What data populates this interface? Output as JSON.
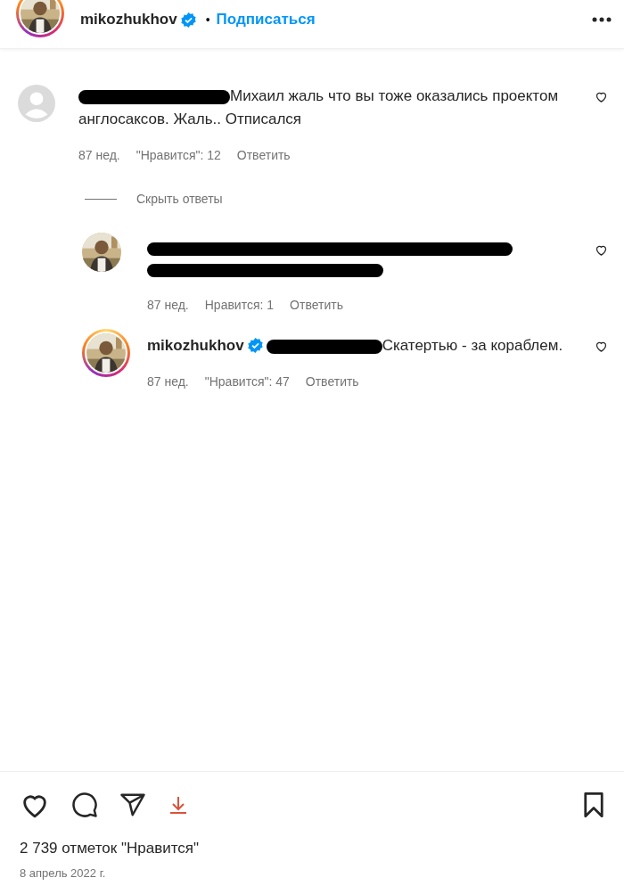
{
  "header": {
    "username": "mikozhukhov",
    "verified": true,
    "separator": "•",
    "follow": "Подписаться",
    "story_ring": true
  },
  "comments": [
    {
      "kind": "text",
      "author_redacted": true,
      "avatar": {
        "kind": "default"
      },
      "story_ring": false,
      "text": "Михаил жаль что вы тоже оказались проектом англосаксов. Жаль.. Отписался",
      "time": "87 нед.",
      "likes": "\"Нравится\": 12",
      "reply": "Ответить",
      "liked": false,
      "hide_replies": "Скрыть ответы",
      "children": [
        {
          "kind": "redacted",
          "story_ring": false,
          "time": "87 нед.",
          "likes": "Нравится: 1",
          "reply": "Ответить",
          "liked": false
        },
        {
          "kind": "text",
          "author": "mikozhukhov",
          "verified": true,
          "mention_redacted": true,
          "story_ring": true,
          "text": "Скатертью - за кораблем.",
          "time": "87 нед.",
          "likes": "\"Нравится\": 47",
          "reply": "Ответить",
          "liked": false
        }
      ]
    }
  ],
  "footer": {
    "liked": false,
    "saved": false,
    "likes": "2 739 отметок \"Нравится\"",
    "date": "8 апрель 2022 г."
  }
}
